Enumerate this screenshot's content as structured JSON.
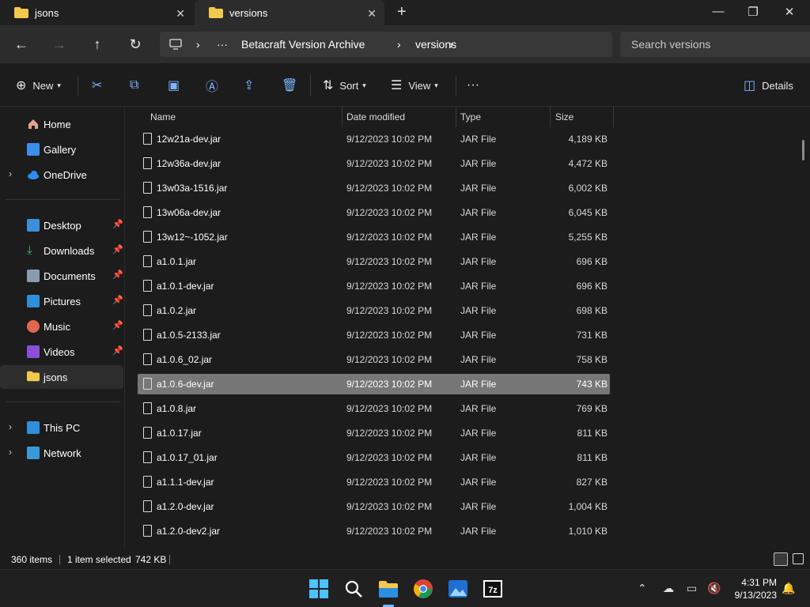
{
  "tabs": [
    {
      "label": "jsons"
    },
    {
      "label": "versions"
    }
  ],
  "window": {
    "new_tab": "+",
    "minimize": "—",
    "maximize": "❐",
    "close": "✕"
  },
  "address": {
    "ellipsis": "···",
    "crumbs": [
      "Betacraft Version Archive",
      "versions"
    ],
    "sep": "›"
  },
  "search": {
    "placeholder": "Search versions"
  },
  "commands": {
    "new": "New",
    "sort": "Sort",
    "view": "View",
    "more": "···",
    "details": "Details"
  },
  "sidebar": {
    "top": [
      {
        "label": "Home"
      },
      {
        "label": "Gallery"
      },
      {
        "label": "OneDrive"
      }
    ],
    "quick": [
      {
        "label": "Desktop"
      },
      {
        "label": "Downloads"
      },
      {
        "label": "Documents"
      },
      {
        "label": "Pictures"
      },
      {
        "label": "Music"
      },
      {
        "label": "Videos"
      },
      {
        "label": "jsons"
      }
    ],
    "bottom": [
      {
        "label": "This PC"
      },
      {
        "label": "Network"
      }
    ]
  },
  "columns": {
    "name": "Name",
    "date": "Date modified",
    "type": "Type",
    "size": "Size"
  },
  "files": [
    {
      "name": "12w21a-dev.jar",
      "date": "9/12/2023 10:02 PM",
      "type": "JAR File",
      "size": "4,189 KB"
    },
    {
      "name": "12w36a-dev.jar",
      "date": "9/12/2023 10:02 PM",
      "type": "JAR File",
      "size": "4,472 KB"
    },
    {
      "name": "13w03a-1516.jar",
      "date": "9/12/2023 10:02 PM",
      "type": "JAR File",
      "size": "6,002 KB"
    },
    {
      "name": "13w06a-dev.jar",
      "date": "9/12/2023 10:02 PM",
      "type": "JAR File",
      "size": "6,045 KB"
    },
    {
      "name": "13w12~-1052.jar",
      "date": "9/12/2023 10:02 PM",
      "type": "JAR File",
      "size": "5,255 KB"
    },
    {
      "name": "a1.0.1.jar",
      "date": "9/12/2023 10:02 PM",
      "type": "JAR File",
      "size": "696 KB"
    },
    {
      "name": "a1.0.1-dev.jar",
      "date": "9/12/2023 10:02 PM",
      "type": "JAR File",
      "size": "696 KB"
    },
    {
      "name": "a1.0.2.jar",
      "date": "9/12/2023 10:02 PM",
      "type": "JAR File",
      "size": "698 KB"
    },
    {
      "name": "a1.0.5-2133.jar",
      "date": "9/12/2023 10:02 PM",
      "type": "JAR File",
      "size": "731 KB"
    },
    {
      "name": "a1.0.6_02.jar",
      "date": "9/12/2023 10:02 PM",
      "type": "JAR File",
      "size": "758 KB"
    },
    {
      "name": "a1.0.6-dev.jar",
      "date": "9/12/2023 10:02 PM",
      "type": "JAR File",
      "size": "743 KB"
    },
    {
      "name": "a1.0.8.jar",
      "date": "9/12/2023 10:02 PM",
      "type": "JAR File",
      "size": "769 KB"
    },
    {
      "name": "a1.0.17.jar",
      "date": "9/12/2023 10:02 PM",
      "type": "JAR File",
      "size": "811 KB"
    },
    {
      "name": "a1.0.17_01.jar",
      "date": "9/12/2023 10:02 PM",
      "type": "JAR File",
      "size": "811 KB"
    },
    {
      "name": "a1.1.1-dev.jar",
      "date": "9/12/2023 10:02 PM",
      "type": "JAR File",
      "size": "827 KB"
    },
    {
      "name": "a1.2.0-dev.jar",
      "date": "9/12/2023 10:02 PM",
      "type": "JAR File",
      "size": "1,004 KB"
    },
    {
      "name": "a1.2.0-dev2.jar",
      "date": "9/12/2023 10:02 PM",
      "type": "JAR File",
      "size": "1,010 KB"
    }
  ],
  "status": {
    "count": "360 items",
    "selection": "1 item selected",
    "size": "742 KB"
  },
  "clock": {
    "time": "4:31 PM",
    "date": "9/13/2023"
  },
  "colors": {
    "accent": "#7bb7ff",
    "selected_row": "#777777",
    "folder": "#f2c94c"
  }
}
